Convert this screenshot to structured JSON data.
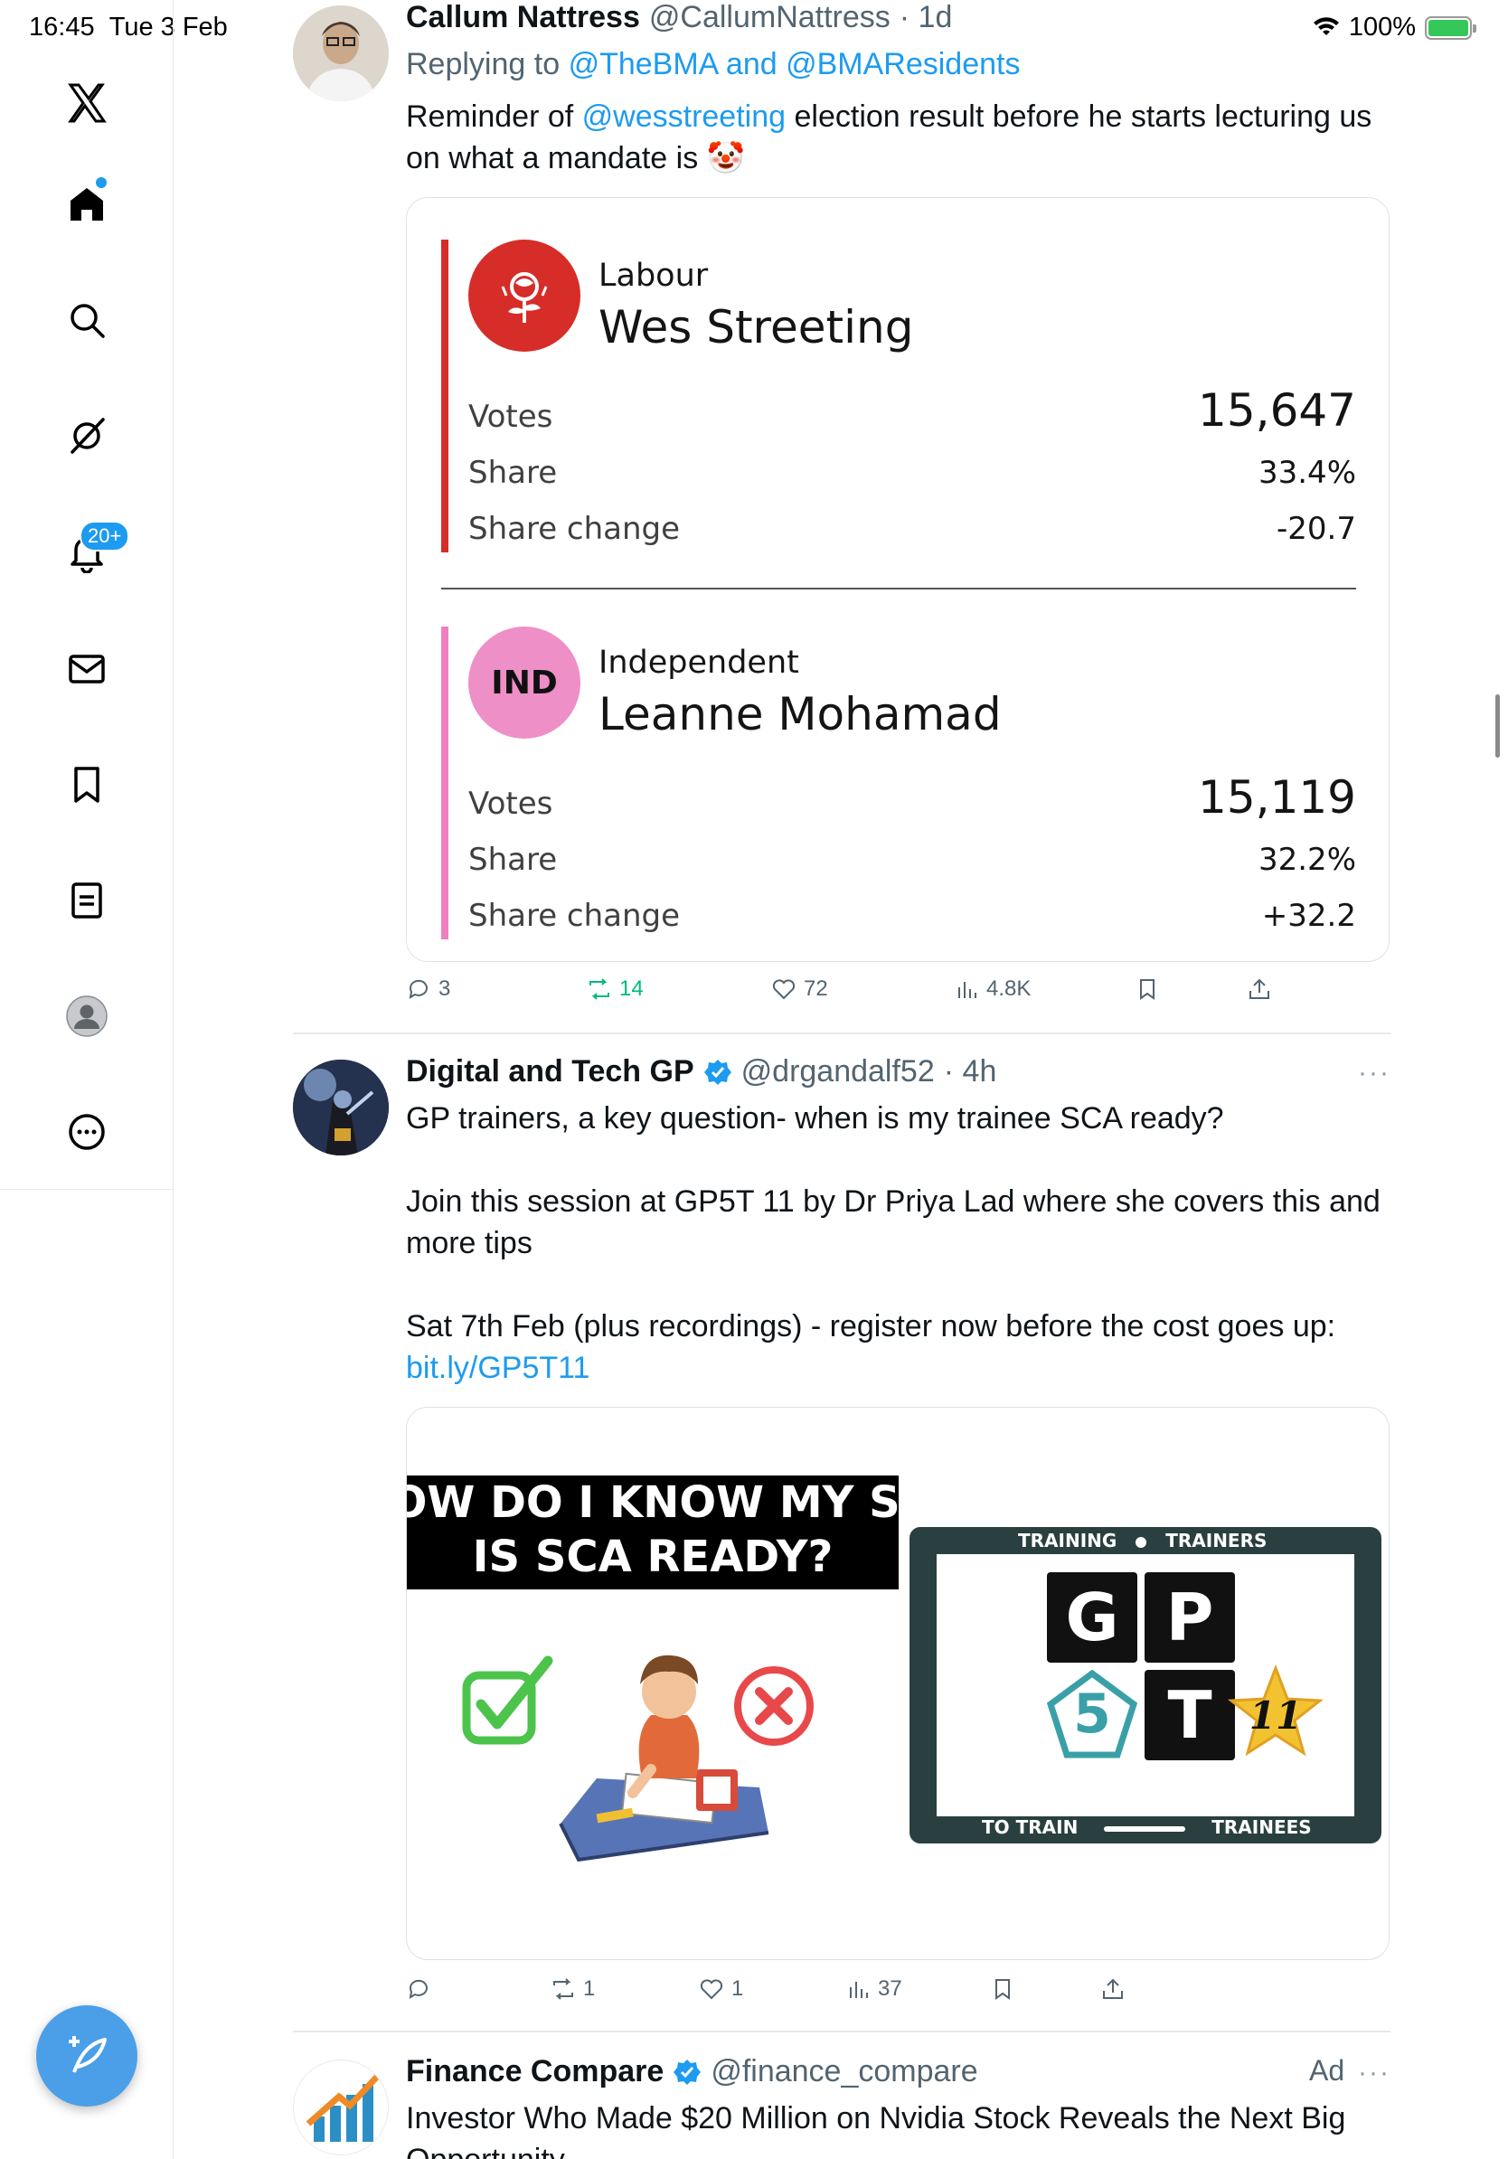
{
  "status_bar": {
    "time": "16:45",
    "date": "Tue 3 Feb",
    "battery": "100%"
  },
  "sidebar": {
    "notifications_badge": "20+",
    "items": [
      {
        "icon": "x-logo-icon"
      },
      {
        "icon": "home-icon"
      },
      {
        "icon": "search-icon"
      },
      {
        "icon": "grok-icon"
      },
      {
        "icon": "bell-icon"
      },
      {
        "icon": "mail-icon"
      },
      {
        "icon": "bookmark-icon"
      },
      {
        "icon": "lists-icon"
      },
      {
        "icon": "profile-icon"
      },
      {
        "icon": "more-icon"
      }
    ]
  },
  "tweets": [
    {
      "name": "Callum Nattress",
      "handle": "@CallumNattress",
      "time": "· 1d",
      "replying_prefix": "Replying to",
      "replying_to": "@TheBMA and @BMAResidents",
      "text_before": "Reminder of",
      "mention": "@wesstreeting",
      "text_after_line1": "election result before he starts lecturing us",
      "text_line2": "on what a mandate is",
      "emoji": "🤡",
      "card": {
        "candidates": [
          {
            "party": "Labour",
            "name": "Wes Streeting",
            "color": "#d62d28",
            "votes_label": "Votes",
            "votes": "15,647",
            "share_label": "Share",
            "share": "33.4%",
            "change_label": "Share change",
            "change": "-20.7"
          },
          {
            "party": "Independent",
            "abbr": "IND",
            "name": "Leanne Mohamad",
            "color": "#ef7fc1",
            "votes_label": "Votes",
            "votes": "15,119",
            "share_label": "Share",
            "share": "32.2%",
            "change_label": "Share change",
            "change": "+32.2"
          }
        ]
      },
      "stats": {
        "replies": "3",
        "reposts": "14",
        "likes": "72",
        "views": "4.8K"
      }
    },
    {
      "name": "Digital and Tech GP",
      "handle": "@drgandalf52",
      "time": "· 4h",
      "more": "···",
      "para1": "GP trainers, a key question- when is my trainee SCA ready?",
      "para2": "Join this session at GP5T 11 by Dr Priya Lad where she covers this and more tips",
      "para3": "Sat 7th Feb (plus recordings) - register now before the cost goes up:",
      "link": "bit.ly/GP5T11",
      "image": {
        "headline_line1": "OW DO I KNOW MY ST",
        "headline_line2": "IS SCA READY?",
        "top_caption_left": "TRAINING",
        "top_caption_right": "TRAINERS",
        "bottom_caption_left": "TO TRAIN",
        "bottom_caption_right": "TRAINEES",
        "tiles": [
          "G",
          "P",
          "5",
          "T",
          "11"
        ]
      },
      "stats": {
        "replies": "",
        "reposts": "1",
        "likes": "1",
        "views": "37"
      }
    },
    {
      "name": "Finance Compare",
      "handle": "@finance_compare",
      "ad_label": "Ad",
      "more": "···",
      "text_line1": "Investor Who Made $20 Million on Nvidia Stock Reveals the Next Big",
      "text_line2": "Opportunity"
    }
  ]
}
